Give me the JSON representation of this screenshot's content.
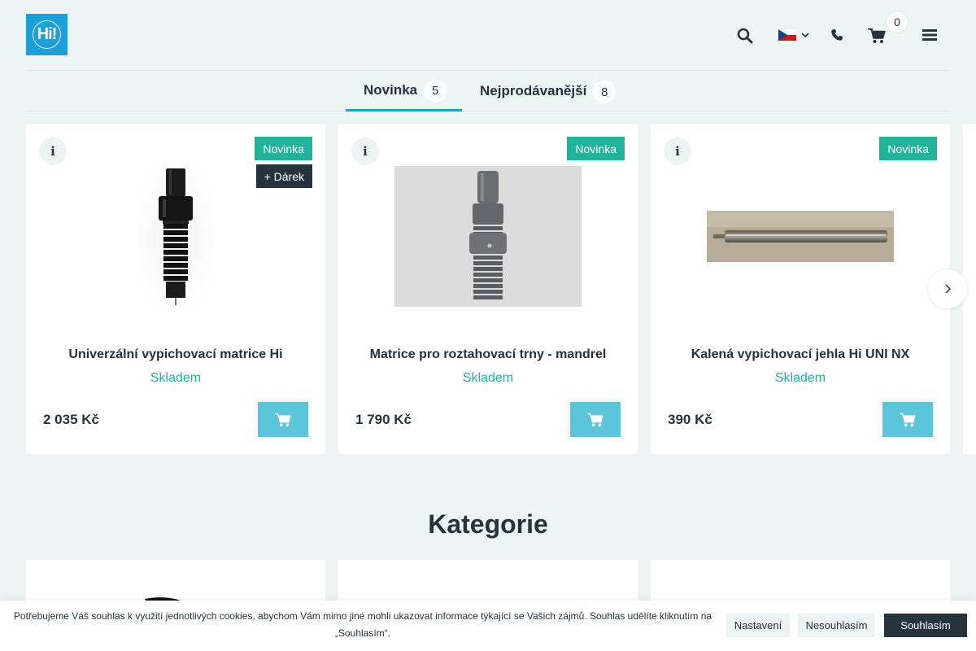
{
  "header": {
    "logo_text": "Hi!",
    "cart_count": "0",
    "language": "cs"
  },
  "tabs": [
    {
      "label": "Novinka",
      "count": "5",
      "active": true
    },
    {
      "label": "Nejprodávanější",
      "count": "8",
      "active": false
    }
  ],
  "products": [
    {
      "title": "Univerzální vypichovací matrice Hi",
      "stock": "Skladem",
      "price": "2 035 Kč",
      "badge": "Novinka",
      "gift": "+ Dárek"
    },
    {
      "title": "Matrice pro roztahovací trny - mandrel",
      "stock": "Skladem",
      "price": "1 790 Kč",
      "badge": "Novinka"
    },
    {
      "title": "Kalená vypichovací jehla Hi UNI NX",
      "stock": "Skladem",
      "price": "390 Kč",
      "badge": "Novinka"
    }
  ],
  "info_glyph": "i",
  "section": {
    "title": "Kategorie"
  },
  "cookie": {
    "text": "Potřebujeme Váš souhlas k využití jednotlivých cookies, abychom Vám mimo jiné mohli ukazovat informace týkající se Vašich zájmů. Souhlas udělíte kliknutím na „Souhlasím“.",
    "settings": "Nastavení",
    "decline": "Nesouhlasím",
    "accept": "Souhlasím"
  },
  "colors": {
    "accent": "#1d9fd8",
    "badge_new": "#22b39b",
    "stock": "#22b39b",
    "cart_button": "#5bc5da",
    "dark": "#24333e",
    "background": "#edf4f5"
  },
  "icons": [
    "search-icon",
    "flag-cz-icon",
    "chevron-down-icon",
    "phone-icon",
    "cart-icon",
    "menu-icon",
    "info-icon",
    "chevron-right-icon"
  ]
}
